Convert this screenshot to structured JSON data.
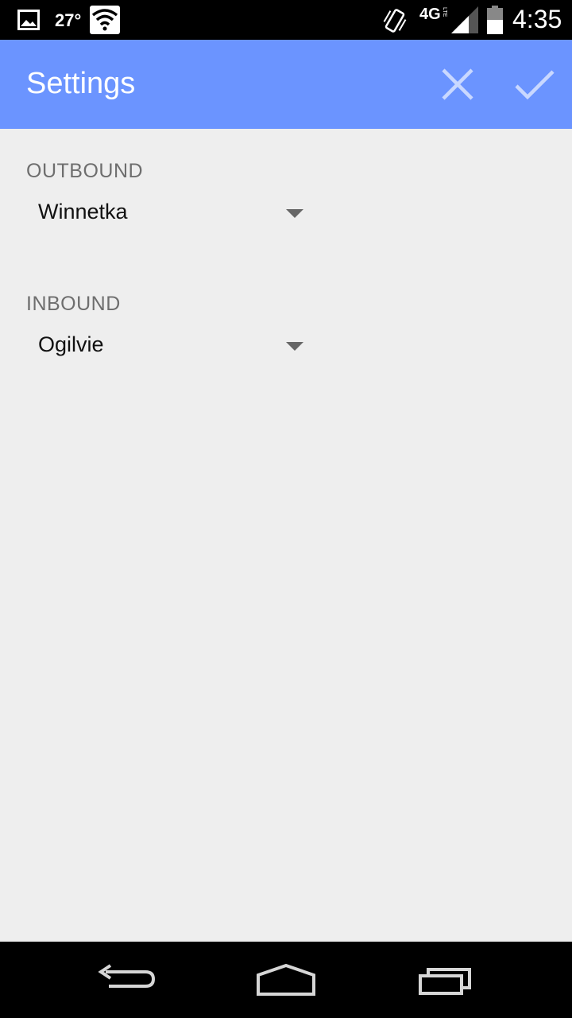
{
  "status_bar": {
    "temperature": "27°",
    "network": "4G",
    "network_sub": "LTE",
    "time": "4:35",
    "icons": [
      "gallery-icon",
      "wifi-icon",
      "vibrate-icon",
      "signal-icon",
      "battery-icon"
    ]
  },
  "action_bar": {
    "title": "Settings",
    "cancel_icon": "close-icon",
    "confirm_icon": "check-icon",
    "color": "#6b94ff"
  },
  "settings": {
    "outbound": {
      "label": "OUTBOUND",
      "selected": "Winnetka"
    },
    "inbound": {
      "label": "INBOUND",
      "selected": "Ogilvie"
    }
  },
  "nav_bar": {
    "icons": [
      "back-icon",
      "home-icon",
      "recents-icon"
    ]
  }
}
